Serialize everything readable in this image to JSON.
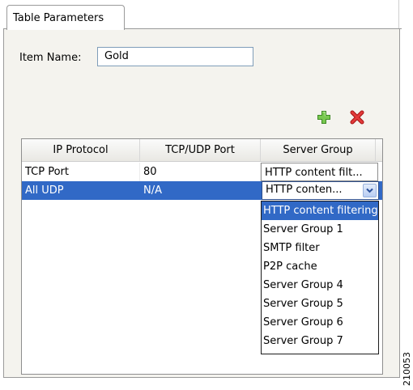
{
  "tab": {
    "label": "Table Parameters"
  },
  "item_name": {
    "label": "Item Name:",
    "value": "Gold"
  },
  "toolbar": {
    "add_icon": "plus-green-icon",
    "delete_icon": "x-red-icon"
  },
  "table": {
    "columns": [
      "IP Protocol",
      "TCP/UDP Port",
      "Server Group"
    ],
    "rows": [
      [
        "TCP Port",
        "80",
        "HTTP content filt..."
      ],
      [
        "All UDP",
        "N/A",
        "HTTP conten..."
      ]
    ]
  },
  "dropdown": {
    "options": [
      "HTTP content filtering",
      "Server Group 1",
      "SMTP filter",
      "P2P cache",
      "Server Group 4",
      "Server Group 5",
      "Server Group 6",
      "Server Group 7"
    ],
    "selected_index": 0
  },
  "figure_id": "210053"
}
